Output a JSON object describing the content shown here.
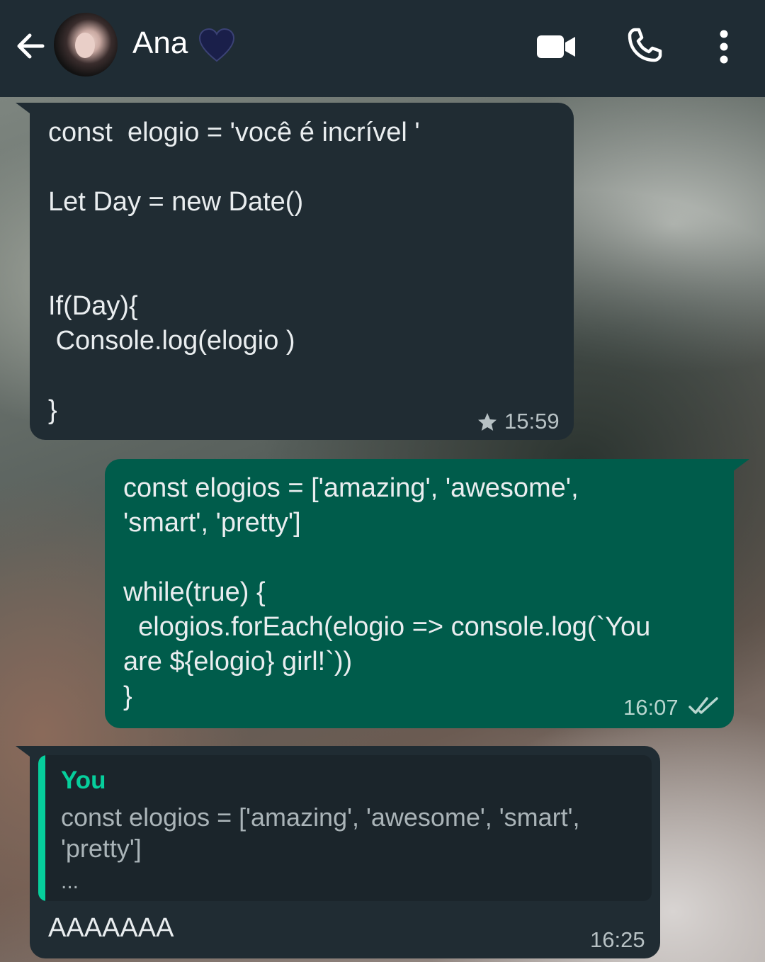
{
  "header": {
    "contact_name": "Ana",
    "heart_emoji": "💙",
    "icons": [
      "back-arrow-icon",
      "avatar",
      "video-call-icon",
      "voice-call-icon",
      "more-options-icon"
    ]
  },
  "messages": [
    {
      "direction": "incoming",
      "text": "const  elogio = 'você é incrível '\n\nLet Day = new Date()\n\n\nIf(Day){\n Console.log(elogio )\n\n}",
      "time": "15:59",
      "starred": true
    },
    {
      "direction": "outgoing",
      "text": "const elogios = ['amazing', 'awesome',\n'smart', 'pretty']\n\nwhile(true) {\n  elogios.forEach(elogio => console.log(`You\nare ${elogio} girl!`))\n}",
      "time": "16:07",
      "status": "read"
    },
    {
      "direction": "incoming",
      "quoted": {
        "author": "You",
        "text": "const elogios = ['amazing', 'awesome', 'smart',\n'pretty']",
        "more": "..."
      },
      "text": "AAAAAAA",
      "time": "16:25"
    }
  ],
  "colors": {
    "header_bg": "#1f2c34",
    "incoming_bubble": "#202c33",
    "outgoing_bubble": "#005c4b",
    "quote_accent": "#06cf9c",
    "text": "#e9edef"
  }
}
